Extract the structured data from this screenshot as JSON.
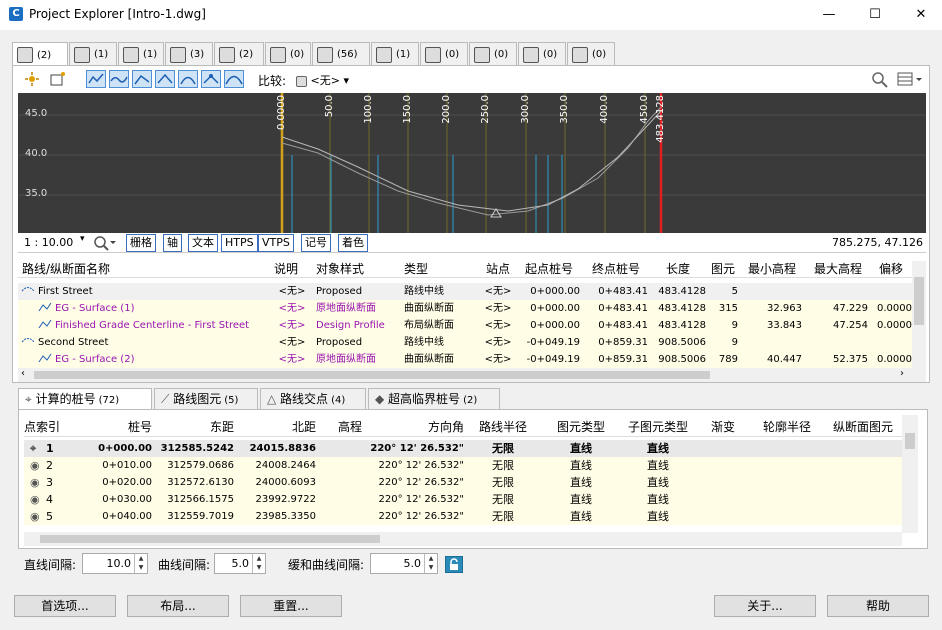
{
  "window": {
    "title": "Project Explorer [Intro-1.dwg]",
    "icon": "C",
    "min": "—",
    "max": "☐",
    "close": "✕"
  },
  "top_tabs": [
    {
      "icon": "alignment-icon",
      "count": "(2)"
    },
    {
      "icon": "structure-icon",
      "count": "(1)"
    },
    {
      "icon": "road-icon",
      "count": "(1)"
    },
    {
      "icon": "corridor-icon",
      "count": "(3)"
    },
    {
      "icon": "surface-icon",
      "count": "(2)"
    },
    {
      "icon": "pipe-icon",
      "count": "(0)"
    },
    {
      "icon": "parcel-icon",
      "count": "(56)"
    },
    {
      "icon": "intersection-icon",
      "count": "(1)"
    },
    {
      "icon": "bridge-icon",
      "count": "(0)"
    },
    {
      "icon": "sample-icon",
      "count": "(0)"
    },
    {
      "icon": "point-icon",
      "count": "(0)"
    },
    {
      "icon": "drawing-icon",
      "count": "(0)"
    }
  ],
  "toolbar": {
    "compare_label": "比较:",
    "compare_value": "<无>"
  },
  "profile_view": {
    "y_labels": [
      "45.0",
      "40.0",
      "35.0"
    ],
    "stations": [
      "0.0000",
      "50.0",
      "100.0",
      "150.0",
      "200.0",
      "250.0",
      "300.0",
      "350.0",
      "400.0",
      "450.0",
      "483.4128"
    ],
    "scale": "1 : 10.00",
    "buttons": [
      "栅格",
      "轴",
      "文本",
      "HTPS",
      "VTPS",
      "记号",
      "着色"
    ],
    "coords": "785.275, 47.126"
  },
  "grid1": {
    "headers": [
      "路线/纵断面名称",
      "说明",
      "对象样式",
      "类型",
      "站点",
      "起点桩号",
      "终点桩号",
      "长度",
      "图元",
      "最小高程",
      "最大高程",
      "偏移"
    ],
    "rows": [
      {
        "name": "First Street",
        "desc": "<无>",
        "style": "Proposed",
        "type": "路线中线",
        "site": "<无>",
        "start": "0+000.00",
        "end": "0+483.41",
        "len": "483.4128",
        "ents": "5",
        "min": "",
        "max": "",
        "off": "",
        "kind": "alignment"
      },
      {
        "name": "EG - Surface (1)",
        "desc": "<无>",
        "style": "原地面纵断面",
        "type": "曲面纵断面",
        "site": "<无>",
        "start": "0+000.00",
        "end": "0+483.41",
        "len": "483.4128",
        "ents": "315",
        "min": "32.963",
        "max": "47.229",
        "off": "0.0000",
        "kind": "profile"
      },
      {
        "name": "Finished Grade Centerline - First Street",
        "desc": "<无>",
        "style": "Design Profile",
        "type": "布局纵断面",
        "site": "<无>",
        "start": "0+000.00",
        "end": "0+483.41",
        "len": "483.4128",
        "ents": "9",
        "min": "33.843",
        "max": "47.254",
        "off": "0.0000",
        "kind": "profile"
      },
      {
        "name": "Second Street",
        "desc": "<无>",
        "style": "Proposed",
        "type": "路线中线",
        "site": "<无>",
        "start": "-0+049.19",
        "end": "0+859.31",
        "len": "908.5006",
        "ents": "9",
        "min": "",
        "max": "",
        "off": "",
        "kind": "alignment"
      },
      {
        "name": "EG - Surface (2)",
        "desc": "<无>",
        "style": "原地面纵断面",
        "type": "曲面纵断面",
        "site": "<无>",
        "start": "-0+049.19",
        "end": "0+859.31",
        "len": "908.5006",
        "ents": "789",
        "min": "40.447",
        "max": "52.375",
        "off": "0.0000",
        "kind": "profile"
      }
    ]
  },
  "bottom_tabs": [
    {
      "label": "计算的桩号",
      "count": "(72)"
    },
    {
      "label": "路线图元",
      "count": "(5)"
    },
    {
      "label": "路线交点",
      "count": "(4)"
    },
    {
      "label": "超高临界桩号",
      "count": "(2)"
    }
  ],
  "grid2": {
    "headers": [
      "点索引",
      "桩号",
      "东距",
      "北距",
      "高程",
      "方向角",
      "路线半径",
      "图元类型",
      "子图元类型",
      "渐变",
      "轮廓半径",
      "纵断面图元"
    ],
    "rows": [
      {
        "idx": "1",
        "sta": "0+000.00",
        "e": "312585.5242",
        "n": "24015.8836",
        "dir": "220° 12' 26.532\"",
        "rad": "无限",
        "type": "直线",
        "sub": "直线"
      },
      {
        "idx": "2",
        "sta": "0+010.00",
        "e": "312579.0686",
        "n": "24008.2464",
        "dir": "220° 12' 26.532\"",
        "rad": "无限",
        "type": "直线",
        "sub": "直线"
      },
      {
        "idx": "3",
        "sta": "0+020.00",
        "e": "312572.6130",
        "n": "24000.6093",
        "dir": "220° 12' 26.532\"",
        "rad": "无限",
        "type": "直线",
        "sub": "直线"
      },
      {
        "idx": "4",
        "sta": "0+030.00",
        "e": "312566.1575",
        "n": "23992.9722",
        "dir": "220° 12' 26.532\"",
        "rad": "无限",
        "type": "直线",
        "sub": "直线"
      },
      {
        "idx": "5",
        "sta": "0+040.00",
        "e": "312559.7019",
        "n": "23985.3350",
        "dir": "220° 12' 26.532\"",
        "rad": "无限",
        "type": "直线",
        "sub": "直线"
      }
    ]
  },
  "spinners": [
    {
      "label": "直线间隔:",
      "value": "10.0"
    },
    {
      "label": "曲线间隔:",
      "value": "5.0"
    },
    {
      "label": "缓和曲线间隔:",
      "value": "5.0"
    }
  ],
  "buttons": {
    "prefs": "首选项...",
    "layout": "布局...",
    "reset": "重置...",
    "about": "关于...",
    "help": "帮助"
  }
}
